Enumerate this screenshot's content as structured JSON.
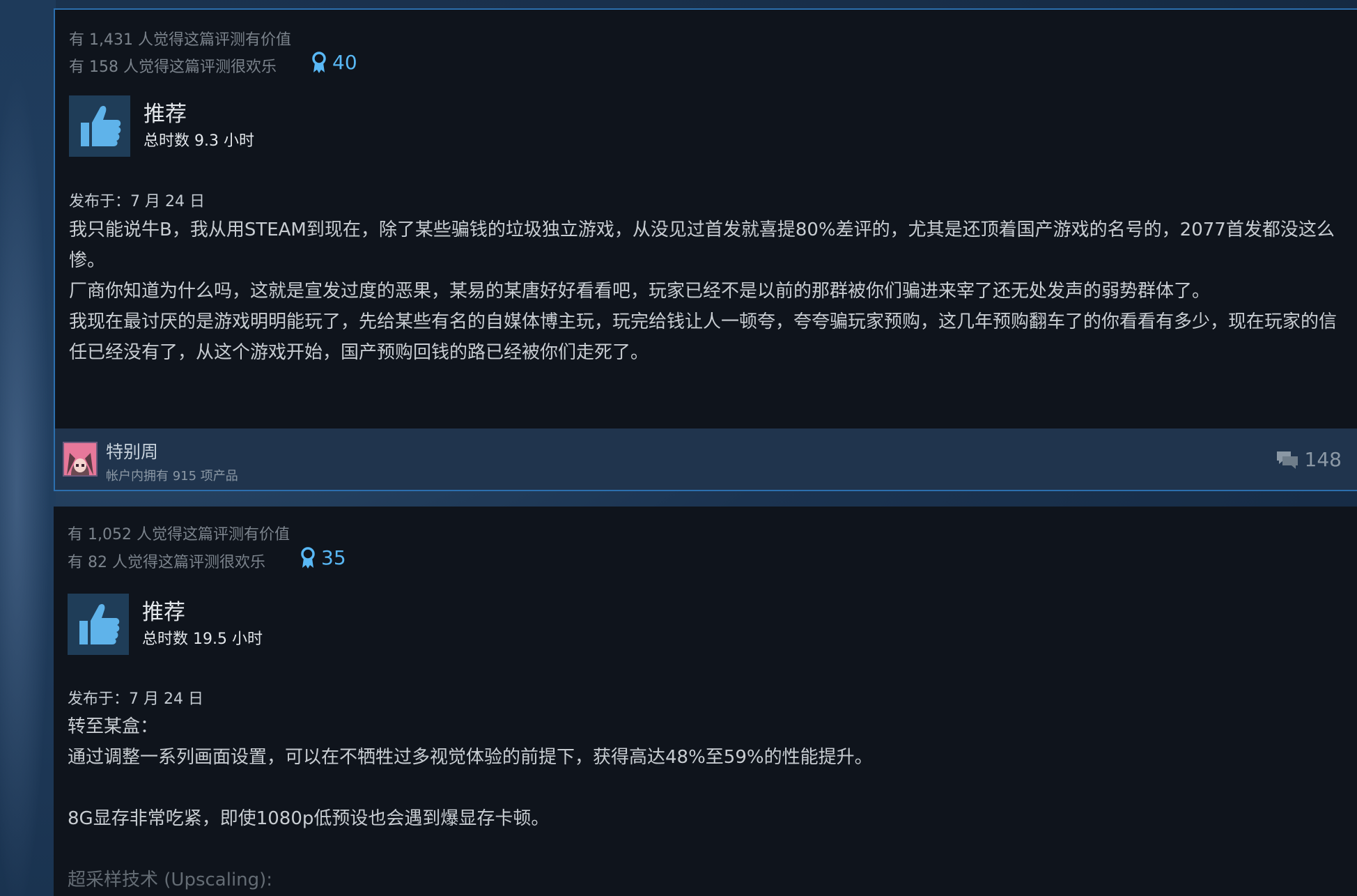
{
  "reviews": [
    {
      "helpful": "有 1,431 人觉得这篇评测有价值",
      "funny": "有 158 人觉得这篇评测很欢乐",
      "awards": "40",
      "verdict": "推荐",
      "hours": "总时数 9.3 小时",
      "posted": "发布于：7 月 24 日",
      "body": [
        "我只能说牛B，我从用STEAM到现在，除了某些骗钱的垃圾独立游戏，从没见过首发就喜提80%差评的，尤其是还顶着国产游戏的名号的，2077首发都没这么惨。",
        "厂商你知道为什么吗，这就是宣发过度的恶果，某易的某唐好好看看吧，玩家已经不是以前的那群被你们骗进来宰了还无处发声的弱势群体了。",
        "我现在最讨厌的是游戏明明能玩了，先给某些有名的自媒体博主玩，玩完给钱让人一顿夸，夸夸骗玩家预购，这几年预购翻车了的你看看有多少，现在玩家的信任已经没有了，从这个游戏开始，国产预购回钱的路已经被你们走死了。"
      ],
      "author": {
        "name": "特别周",
        "products": "帐户内拥有 915 项产品"
      },
      "comments": "148"
    },
    {
      "helpful": "有 1,052 人觉得这篇评测有价值",
      "funny": "有 82 人觉得这篇评测很欢乐",
      "awards": "35",
      "verdict": "推荐",
      "hours": "总时数 19.5 小时",
      "posted": "发布于：7 月 24 日",
      "body": [
        "转至某盒：",
        "通过调整一系列画面设置，可以在不牺牲过多视觉体验的前提下，获得高达48%至59%的性能提升。",
        "",
        "8G显存非常吃紧，即使1080p低预设也会遇到爆显存卡顿。",
        "",
        "超采样技术 (Upscaling):"
      ]
    }
  ],
  "colors": {
    "accent_blue": "#59b8f5",
    "panel_bg": "#0f141c",
    "author_bar_bg": "#20344d",
    "thumb_box_bg": "#1f3d58"
  },
  "icons": {
    "award": "award-ribbon-icon",
    "thumb": "thumbs-up-icon",
    "comments": "speech-bubbles-icon"
  }
}
